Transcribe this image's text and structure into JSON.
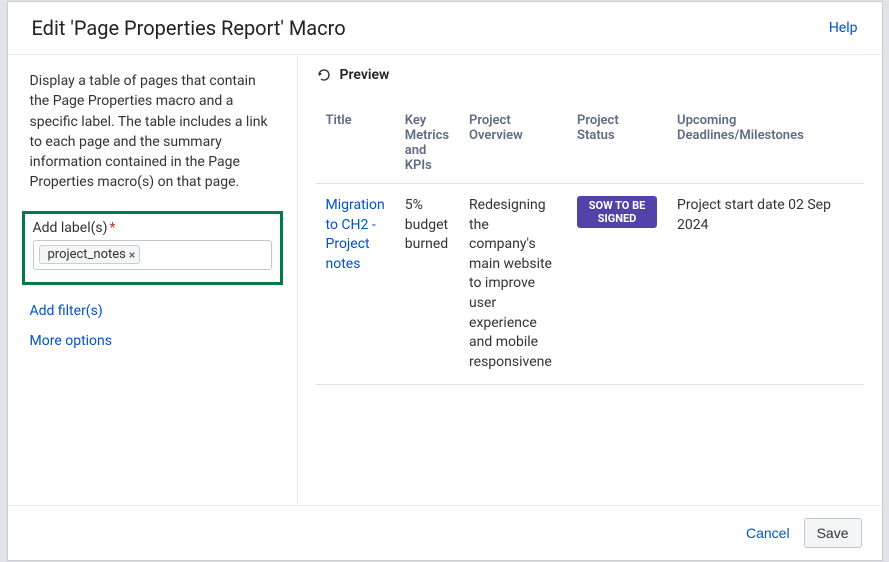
{
  "header": {
    "title": "Edit 'Page Properties Report' Macro",
    "help_label": "Help"
  },
  "sidebar": {
    "description": "Display a table of pages that contain the Page Properties macro and a specific label. The table includes a link to each page and the summary information contained in the Page Properties macro(s) on that page.",
    "label_field_label": "Add label(s)",
    "label_token": "project_notes",
    "add_filters": "Add filter(s)",
    "more_options": "More options"
  },
  "preview": {
    "heading": "Preview",
    "columns": {
      "title": "Title",
      "kpis": "Key Metrics and KPIs",
      "overview": "Project Overview",
      "status": "Project Status",
      "deadlines": "Upcoming Deadlines/Milestones"
    },
    "row": {
      "title": "Migration to CH2 - Project notes",
      "kpis": "5% budget burned",
      "overview": "Redesigning the company's main website to improve user experience and mobile responsivene",
      "status": "SOW TO BE SIGNED",
      "deadlines": "Project start date 02 Sep 2024"
    }
  },
  "footer": {
    "cancel": "Cancel",
    "save": "Save"
  }
}
